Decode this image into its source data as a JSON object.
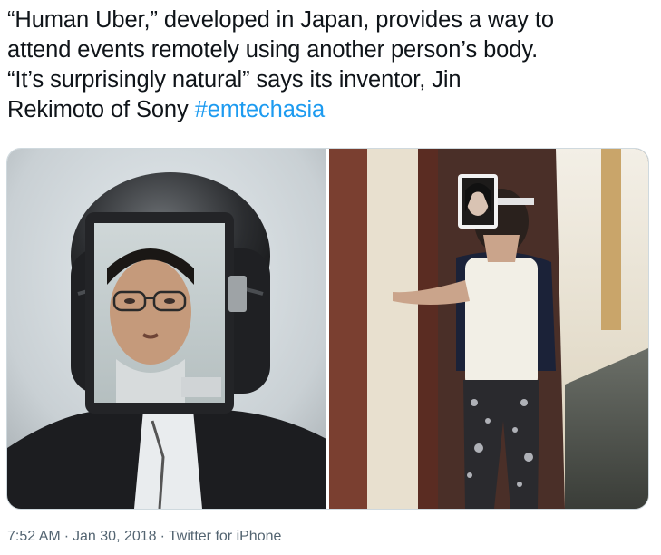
{
  "tweet": {
    "text_line1": "“Human Uber,” developed in Japan, provides a way to",
    "text_line2": "attend events remotely using another person’s body.",
    "text_line3": "“It’s surprisingly natural” says its inventor, Jin",
    "text_line4_prefix": "Rekimoto of Sony ",
    "hashtag": "#emtechasia"
  },
  "media": {
    "photos": [
      {
        "icon": "photo-man-wearing-helmet-with-tablet-face"
      },
      {
        "icon": "photo-woman-with-tablet-on-face-in-hallway"
      }
    ]
  },
  "meta": {
    "time": "7:52 AM",
    "separator": "·",
    "date": "Jan 30, 2018",
    "source": "Twitter for iPhone"
  },
  "colors": {
    "link": "#1d9bf0",
    "text": "#0f1419",
    "secondary": "#536471",
    "border": "#cfd9de"
  }
}
